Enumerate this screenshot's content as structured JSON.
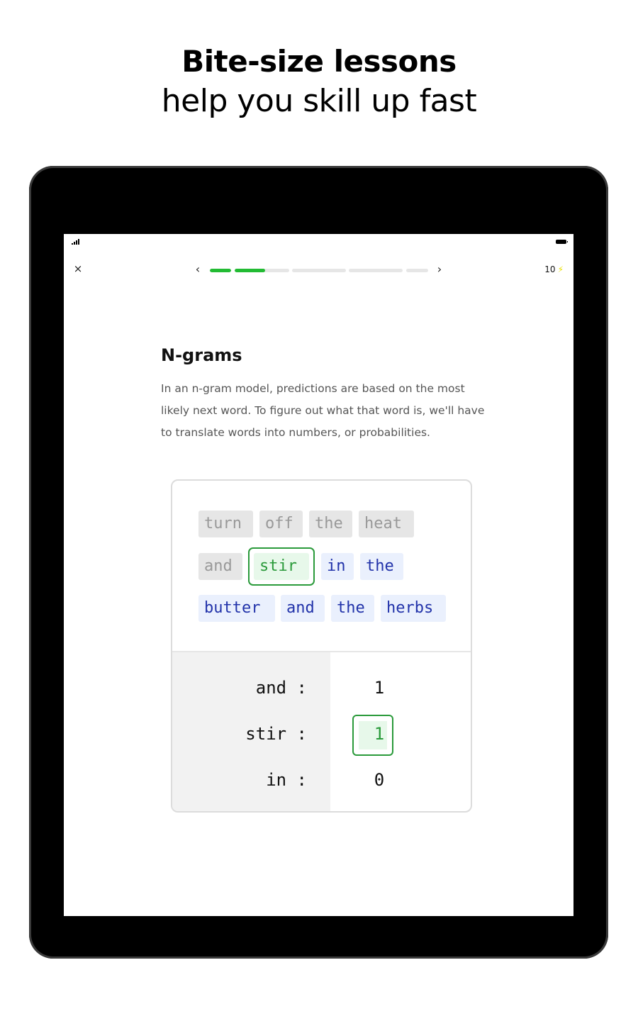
{
  "headline": {
    "bold": "Bite-size lessons",
    "light": "help you skill up fast"
  },
  "status_bar": {
    "signal_icon": "signal-bars-icon",
    "battery_icon": "battery-icon"
  },
  "top_bar": {
    "close_label": "×",
    "prev_label": "‹",
    "next_label": "›",
    "progress_segments": [
      {
        "progress": 1.0
      },
      {
        "progress": 0.56
      },
      {
        "progress": 0.0
      },
      {
        "progress": 0.0
      },
      {
        "progress": 0.0
      }
    ],
    "energy_count": "10",
    "energy_icon": "⚡"
  },
  "lesson": {
    "title": "N-grams",
    "body": "In an n-gram model, predictions are based on the most likely next word. To figure out what that word is, we'll have to translate words into numbers, or probabilities."
  },
  "tokens": [
    {
      "text": "turn",
      "state": "past"
    },
    {
      "text": "off",
      "state": "past"
    },
    {
      "text": "the",
      "state": "past"
    },
    {
      "text": "heat",
      "state": "past"
    },
    {
      "text": "and",
      "state": "past"
    },
    {
      "text": "stir",
      "state": "current"
    },
    {
      "text": "in",
      "state": "future"
    },
    {
      "text": "the",
      "state": "future"
    },
    {
      "text": "butter",
      "state": "future"
    },
    {
      "text": "and",
      "state": "future"
    },
    {
      "text": "the",
      "state": "future"
    },
    {
      "text": "herbs",
      "state": "future"
    }
  ],
  "counts": [
    {
      "word": "and :",
      "value": "1",
      "highlighted": false
    },
    {
      "word": "stir :",
      "value": "1",
      "highlighted": true
    },
    {
      "word": "in :",
      "value": "0",
      "highlighted": false
    }
  ],
  "colors": {
    "accent_green": "#22bb33",
    "current_text": "#2a9a3a",
    "future_text": "#2233aa",
    "past_text": "#999999",
    "energy_bolt": "#e8e000"
  }
}
